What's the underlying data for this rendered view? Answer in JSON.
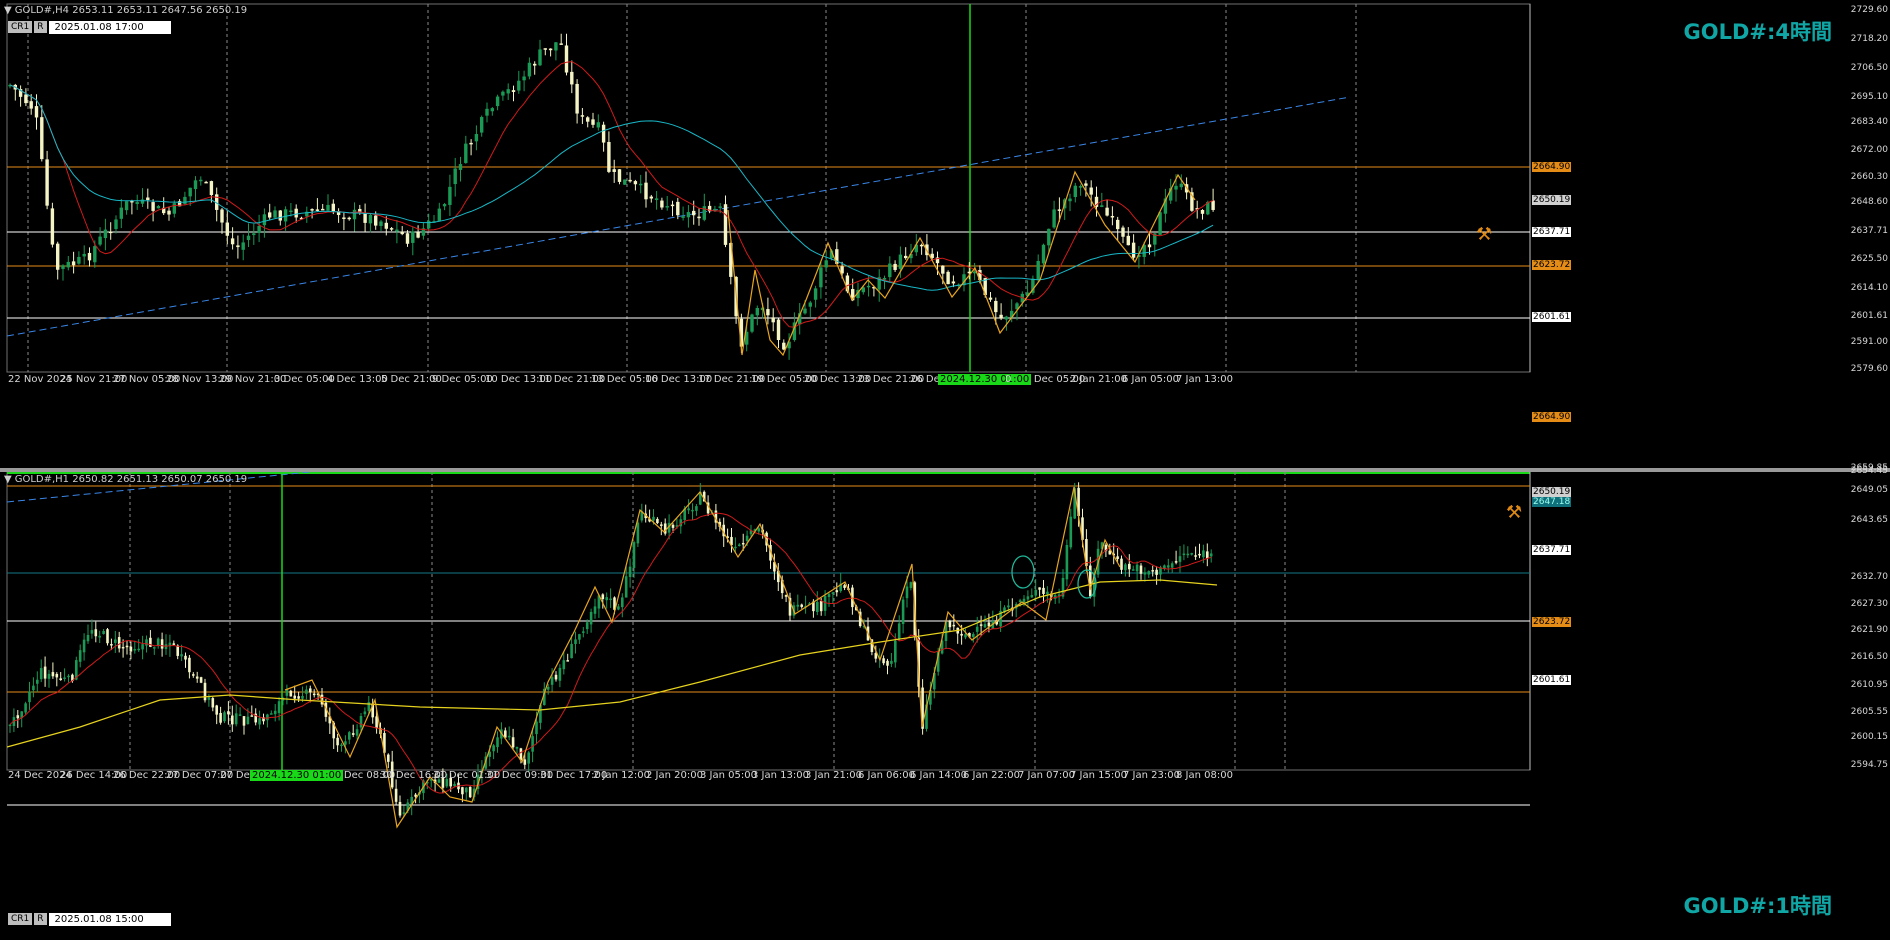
{
  "pane1": {
    "header": "GOLD#,H4  2653.11 2653.11 2647.56 2650.19",
    "time_tags": [
      "CR1",
      "R"
    ],
    "time_value": "2025.01.08 17:00",
    "title": "GOLD#:4時間",
    "y_ticks": [
      "2729.60",
      "2718.20",
      "2706.50",
      "2695.10",
      "2683.40",
      "2672.00",
      "2660.30",
      "2648.60",
      "2637.71",
      "2625.50",
      "2614.10",
      "2601.61",
      "2591.00",
      "2579.60"
    ],
    "level_tags": [
      {
        "label": "2664.90",
        "color": "#e58c17",
        "text": "#000"
      },
      {
        "label": "2650.19",
        "color": "#d0d0d0",
        "text": "#000"
      },
      {
        "label": "2637.71",
        "color": "#ffffff",
        "text": "#000"
      },
      {
        "label": "2623.72",
        "color": "#e58c17",
        "text": "#000"
      },
      {
        "label": "2601.61",
        "color": "#ffffff",
        "text": "#000"
      }
    ],
    "x_labels": [
      "22 Nov 2024",
      "25 Nov 21:00",
      "27 Nov 05:00",
      "28 Nov 13:00",
      "29 Nov 21:00",
      "3 Dec 05:00",
      "4 Dec 13:00",
      "5 Dec 21:00",
      "9 Dec 05:00",
      "10 Dec 13:00",
      "11 Dec 21:00",
      "13 Dec 05:00",
      "16 Dec 13:00",
      "17 Dec 21:00",
      "19 Dec 05:00",
      "20 Dec 13:00",
      "23 Dec 21:00",
      "26 Dec",
      "31 Dec 05:00",
      "2 Jan 21:00",
      "6 Jan 05:00",
      "7 Jan 13:00"
    ],
    "cursor_label": "2024.12.30 01:00",
    "cursor_tail": "0"
  },
  "pane2": {
    "header": "GOLD#,H1  2650.82 2651.13 2650.07 2650.19",
    "time_tags": [
      "CR1",
      "R"
    ],
    "time_value": "2025.01.08 15:00",
    "title": "GOLD#:1時間",
    "y_ticks": [
      "2659.85",
      "2654.45",
      "2649.05",
      "2643.65",
      "2632.70",
      "2627.30",
      "2621.90",
      "2616.50",
      "2610.95",
      "2605.55",
      "2600.15",
      "2594.75"
    ],
    "level_tags": [
      {
        "label": "2664.90",
        "color": "#e58c17",
        "text": "#000"
      },
      {
        "label": "2650.19",
        "color": "#d0d0d0",
        "text": "#000"
      },
      {
        "label": "2647.18",
        "color": "#0f6f7a",
        "text": "#9fe"
      },
      {
        "label": "2637.71",
        "color": "#ffffff",
        "text": "#000"
      },
      {
        "label": "2623.72",
        "color": "#e58c17",
        "text": "#000"
      },
      {
        "label": "2601.61",
        "color": "#ffffff",
        "text": "#000"
      }
    ],
    "x_labels": [
      "24 Dec 2024",
      "26 Dec 14:00",
      "26 Dec 22:00",
      "27 Dec 07:00",
      "27 Dec",
      "30 Dec 08:00",
      "30 Dec 16:00",
      "31 Dec 01:00",
      "31 Dec 09:00",
      "31 Dec 17:00",
      "2 Jan 12:00",
      "2 Jan 20:00",
      "3 Jan 05:00",
      "3 Jan 13:00",
      "3 Jan 21:00",
      "6 Jan 06:00",
      "6 Jan 14:00",
      "6 Jan 22:00",
      "7 Jan 07:00",
      "7 Jan 15:00",
      "7 Jan 23:00",
      "8 Jan 08:00"
    ],
    "cursor_label": "2024.12.30 01:00"
  },
  "colors": {
    "bull": "#1a9a55",
    "bear": "#f4f4c4",
    "ma_fast": "#d11a1a",
    "ma_slow_h4": "#18b8c8",
    "ma_slow_h1": "#e6d21e",
    "zigzag": "#e8a51e",
    "trend": "#3a86e8",
    "cursor": "#18d818",
    "orange_level": "#e58c17",
    "white_level": "#ffffff",
    "title": "#11a6a6"
  },
  "icons": {
    "pane1_marker": "cross-tools-icon",
    "pane2_marker": "cross-tools-icon"
  }
}
